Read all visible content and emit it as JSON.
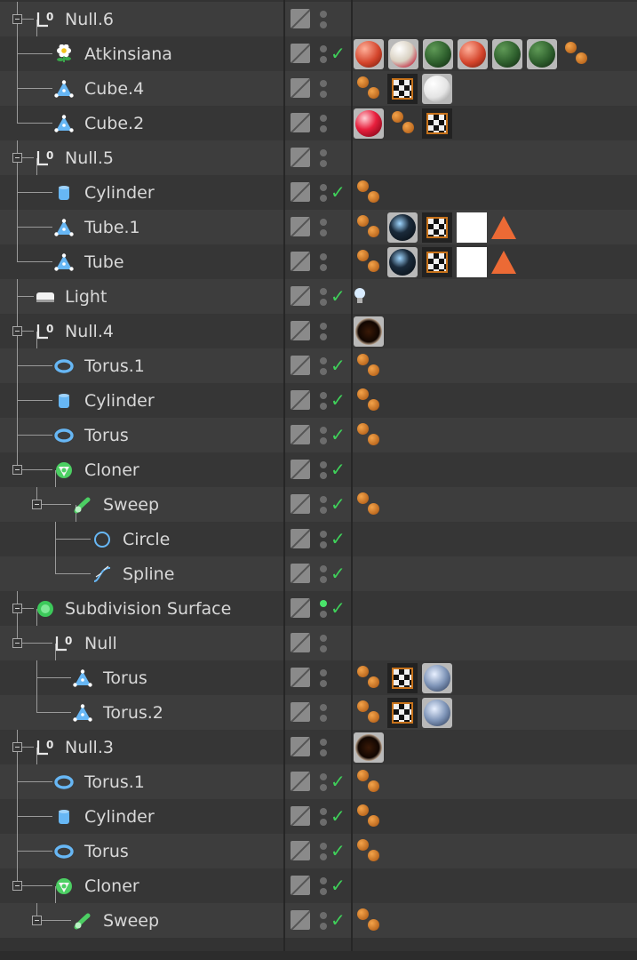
{
  "panel": "object-manager",
  "colors": {
    "row_odd": "#3d3d3d",
    "row_even": "#363636",
    "text": "#d8d8d8",
    "check": "#3fd15a",
    "tree_line": "#9a9a9a",
    "bone_tag": "#e08a30",
    "triangle_tag": "#ec6a35"
  },
  "objects": [
    {
      "label": "Null.6",
      "depth": 0,
      "icon": "null-icon",
      "expandable": true,
      "check": false,
      "dot_green": false,
      "tags": []
    },
    {
      "label": "Atkinsiana",
      "depth": 1,
      "icon": "flower-icon",
      "expandable": false,
      "check": true,
      "dot_green": false,
      "tags": [
        "material-red-ball",
        "material-cream-ball",
        "material-green-ball",
        "material-red-ball",
        "material-green-ball",
        "material-green-ball",
        "texture-tag"
      ]
    },
    {
      "label": "Cube.4",
      "depth": 1,
      "icon": "polygon-object-icon",
      "expandable": false,
      "check": false,
      "dot_green": false,
      "tags": [
        "texture-tag",
        "checker-material",
        "material-white-ball"
      ]
    },
    {
      "label": "Cube.2",
      "depth": 1,
      "icon": "polygon-object-icon",
      "expandable": false,
      "check": false,
      "dot_green": false,
      "tags": [
        "material-glossy-red-ball",
        "texture-tag",
        "checker-material"
      ]
    },
    {
      "label": "Null.5",
      "depth": 0,
      "icon": "null-icon",
      "expandable": true,
      "check": false,
      "dot_green": false,
      "tags": []
    },
    {
      "label": "Cylinder",
      "depth": 1,
      "icon": "cylinder-icon",
      "expandable": false,
      "check": true,
      "dot_green": false,
      "tags": [
        "texture-tag"
      ]
    },
    {
      "label": "Tube.1",
      "depth": 1,
      "icon": "polygon-object-icon",
      "expandable": false,
      "check": false,
      "dot_green": false,
      "tags": [
        "texture-tag",
        "material-dark-ball",
        "checker-material",
        "white-material",
        "triangle-tag"
      ]
    },
    {
      "label": "Tube",
      "depth": 1,
      "icon": "polygon-object-icon",
      "expandable": false,
      "check": false,
      "dot_green": false,
      "tags": [
        "texture-tag",
        "material-dark-ball",
        "checker-material",
        "white-material",
        "triangle-tag"
      ]
    },
    {
      "label": "Light",
      "depth": 0,
      "icon": "light-icon",
      "expandable": false,
      "check": true,
      "dot_green": false,
      "tags": [
        "light-bulb-tag"
      ]
    },
    {
      "label": "Null.4",
      "depth": 0,
      "icon": "null-icon",
      "expandable": true,
      "check": false,
      "dot_green": false,
      "tags": [
        "material-dark-brown-ball"
      ]
    },
    {
      "label": "Torus.1",
      "depth": 1,
      "icon": "torus-icon",
      "expandable": false,
      "check": true,
      "dot_green": false,
      "tags": [
        "texture-tag"
      ]
    },
    {
      "label": "Cylinder",
      "depth": 1,
      "icon": "cylinder-icon",
      "expandable": false,
      "check": true,
      "dot_green": false,
      "tags": [
        "texture-tag"
      ]
    },
    {
      "label": "Torus",
      "depth": 1,
      "icon": "torus-icon",
      "expandable": false,
      "check": true,
      "dot_green": false,
      "tags": [
        "texture-tag"
      ]
    },
    {
      "label": "Cloner",
      "depth": 1,
      "icon": "cloner-icon",
      "expandable": true,
      "check": true,
      "dot_green": false,
      "tags": []
    },
    {
      "label": "Sweep",
      "depth": 2,
      "icon": "sweep-icon",
      "expandable": true,
      "check": true,
      "dot_green": false,
      "tags": [
        "texture-tag"
      ]
    },
    {
      "label": "Circle",
      "depth": 3,
      "icon": "circle-spline-icon",
      "expandable": false,
      "check": true,
      "dot_green": false,
      "tags": []
    },
    {
      "label": "Spline",
      "depth": 3,
      "icon": "spline-icon",
      "expandable": false,
      "check": true,
      "dot_green": false,
      "tags": []
    },
    {
      "label": "Subdivision Surface",
      "depth": 0,
      "icon": "subdivision-surface-icon",
      "expandable": true,
      "check": true,
      "dot_green": true,
      "tags": []
    },
    {
      "label": "Null",
      "depth": 1,
      "icon": "null-icon",
      "expandable": true,
      "check": false,
      "dot_green": false,
      "tags": []
    },
    {
      "label": "Torus",
      "depth": 2,
      "icon": "polygon-object-icon",
      "expandable": false,
      "check": false,
      "dot_green": false,
      "tags": [
        "texture-tag",
        "checker-material",
        "material-noise-ball"
      ]
    },
    {
      "label": "Torus.2",
      "depth": 2,
      "icon": "polygon-object-icon",
      "expandable": false,
      "check": false,
      "dot_green": false,
      "tags": [
        "texture-tag",
        "checker-material",
        "material-noise-ball"
      ]
    },
    {
      "label": "Null.3",
      "depth": 0,
      "icon": "null-icon",
      "expandable": true,
      "check": false,
      "dot_green": false,
      "tags": [
        "material-dark-brown-ball"
      ]
    },
    {
      "label": "Torus.1",
      "depth": 1,
      "icon": "torus-icon",
      "expandable": false,
      "check": true,
      "dot_green": false,
      "tags": [
        "texture-tag"
      ]
    },
    {
      "label": "Cylinder",
      "depth": 1,
      "icon": "cylinder-icon",
      "expandable": false,
      "check": true,
      "dot_green": false,
      "tags": [
        "texture-tag"
      ]
    },
    {
      "label": "Torus",
      "depth": 1,
      "icon": "torus-icon",
      "expandable": false,
      "check": true,
      "dot_green": false,
      "tags": [
        "texture-tag"
      ]
    },
    {
      "label": "Cloner",
      "depth": 1,
      "icon": "cloner-icon",
      "expandable": true,
      "check": true,
      "dot_green": false,
      "tags": []
    },
    {
      "label": "Sweep",
      "depth": 2,
      "icon": "sweep-icon",
      "expandable": true,
      "check": true,
      "dot_green": false,
      "tags": [
        "texture-tag"
      ]
    }
  ]
}
